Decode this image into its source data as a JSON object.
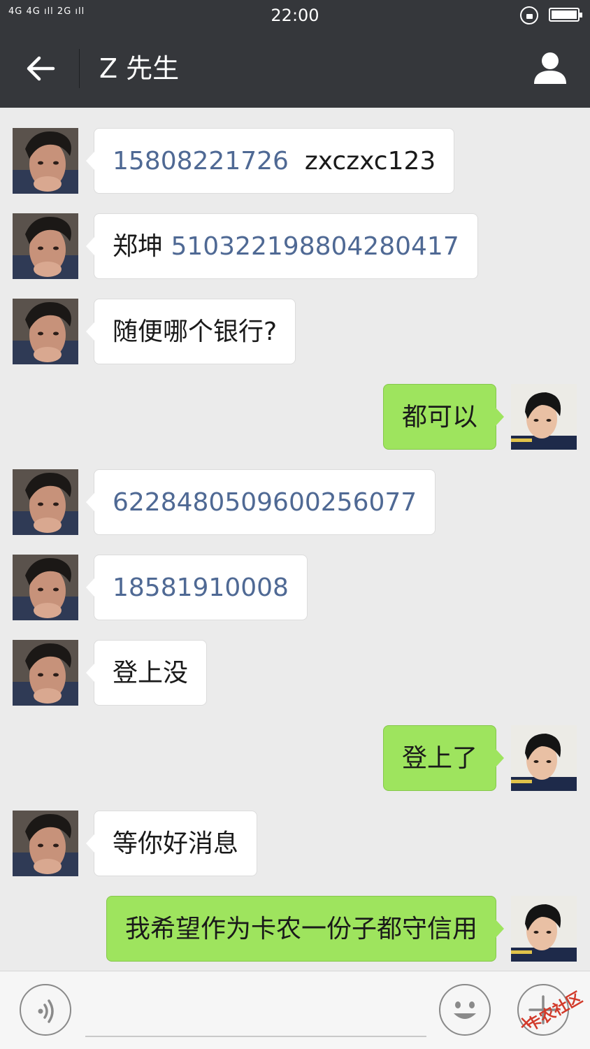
{
  "status_bar": {
    "signal_text": "4G 4G ıll 2G ıll",
    "time": "22:00"
  },
  "header": {
    "title": "Z 先生",
    "back_icon": "arrow-left-icon",
    "profile_icon": "person-icon"
  },
  "messages": [
    {
      "side": "in",
      "parts": [
        {
          "text": "15808221726",
          "kind": "number"
        },
        {
          "text": "  zxczxc123",
          "kind": "text"
        }
      ]
    },
    {
      "side": "in",
      "parts": [
        {
          "text": "郑坤 ",
          "kind": "text"
        },
        {
          "text": "510322198804280417",
          "kind": "number"
        }
      ]
    },
    {
      "side": "in",
      "parts": [
        {
          "text": "随便哪个银行?",
          "kind": "text"
        }
      ]
    },
    {
      "side": "out",
      "parts": [
        {
          "text": "都可以",
          "kind": "text"
        }
      ]
    },
    {
      "side": "in",
      "parts": [
        {
          "text": "6228480509600256077",
          "kind": "number"
        }
      ]
    },
    {
      "side": "in",
      "parts": [
        {
          "text": "18581910008",
          "kind": "number"
        }
      ]
    },
    {
      "side": "in",
      "parts": [
        {
          "text": "登上没",
          "kind": "text"
        }
      ]
    },
    {
      "side": "out",
      "parts": [
        {
          "text": "登上了",
          "kind": "text"
        }
      ]
    },
    {
      "side": "in",
      "parts": [
        {
          "text": "等你好消息",
          "kind": "text"
        }
      ]
    },
    {
      "side": "out",
      "parts": [
        {
          "text": "我希望作为卡农一份子都守信用",
          "kind": "text"
        }
      ]
    }
  ],
  "input_bar": {
    "voice_icon": "voice-icon",
    "emoji_icon": "smiley-icon",
    "plus_icon": "plus-icon",
    "watermark": "卡农社区"
  },
  "colors": {
    "header_bg": "#35373b",
    "chat_bg": "#ebebeb",
    "outgoing_bubble": "#9ee45e",
    "incoming_bubble": "#ffffff",
    "number_link": "#4f6994"
  }
}
